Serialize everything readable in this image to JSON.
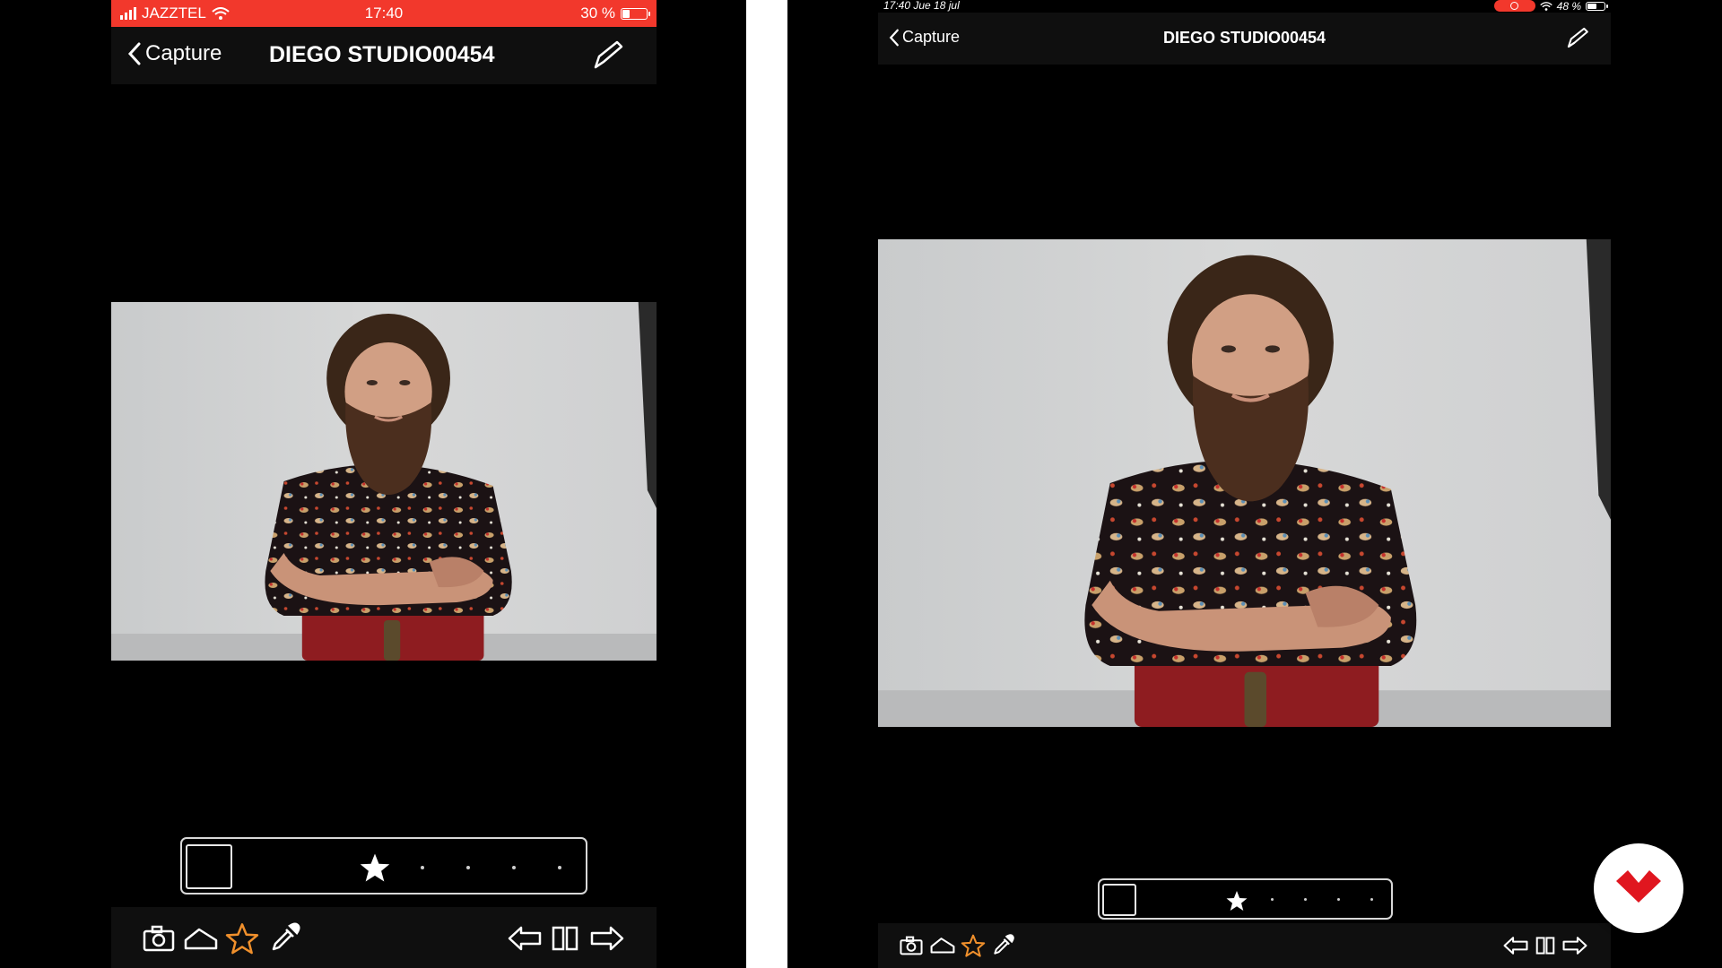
{
  "phone": {
    "status": {
      "carrier": "JAZZTEL",
      "time": "17:40",
      "battery": "30 %",
      "battery_level": 0.3
    },
    "nav": {
      "back_label": "Capture",
      "title": "DIEGO STUDIO00454"
    },
    "rating": {
      "stars": 1
    }
  },
  "tablet": {
    "status": {
      "datetime": "17:40  Jue 18 jul",
      "battery": "48 %",
      "battery_level": 0.48
    },
    "nav": {
      "back_label": "Capture",
      "title": "DIEGO STUDIO00454"
    },
    "rating": {
      "stars": 1
    }
  },
  "toolbar_icons": [
    "camera-icon",
    "exposure-icon",
    "star-icon",
    "eyedropper-icon",
    "prev-arrow-icon",
    "compare-icon",
    "next-arrow-icon"
  ],
  "colors": {
    "status_red": "#f2382c",
    "accent_orange": "#f0902c",
    "logo_red": "#e0161f",
    "backdrop": "#d4d5d5",
    "chair_red": "#8e1c20"
  }
}
